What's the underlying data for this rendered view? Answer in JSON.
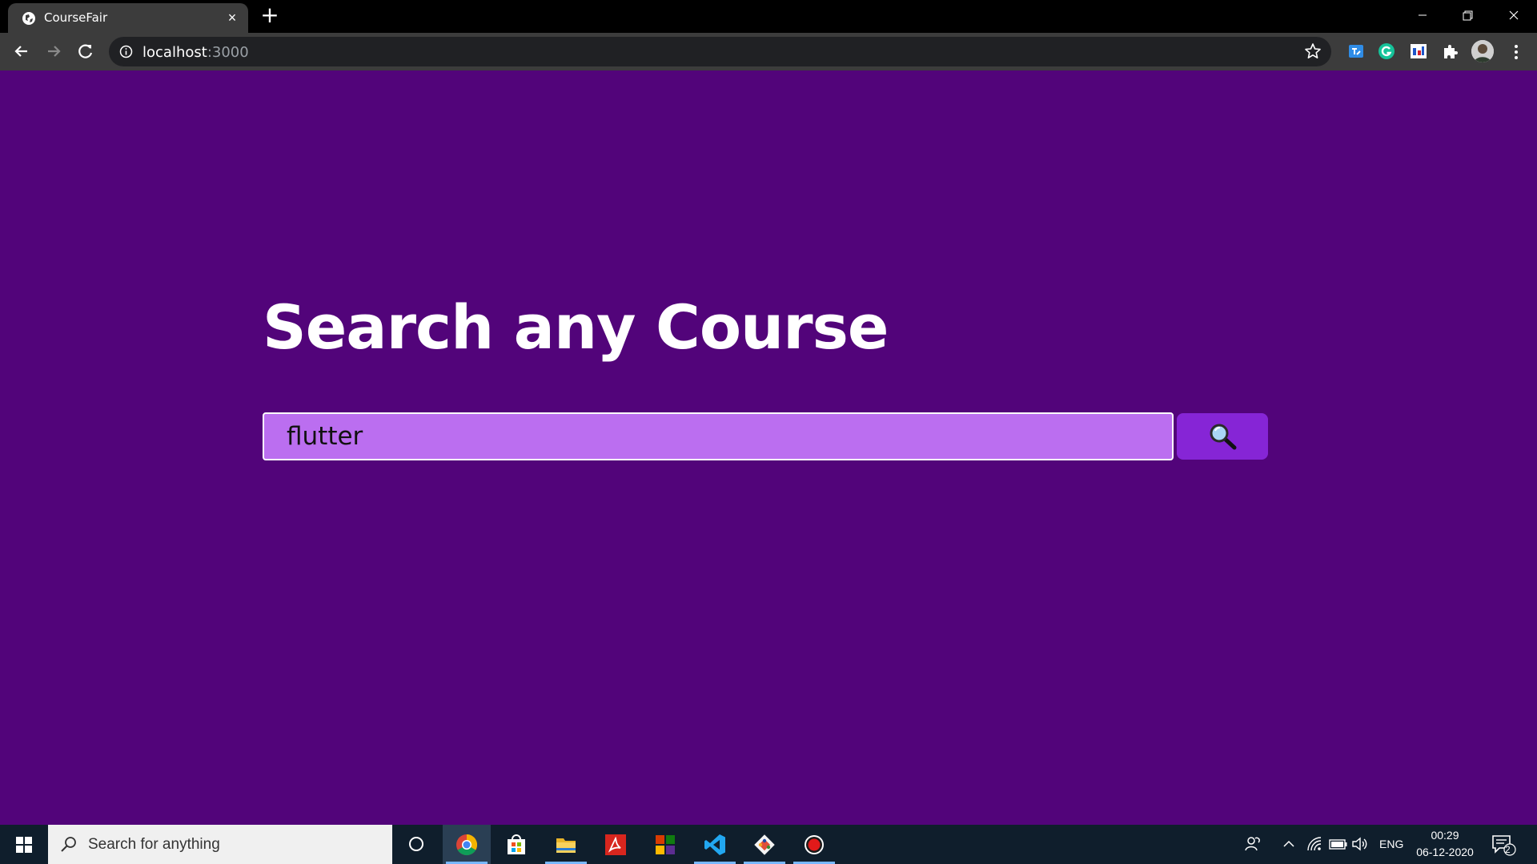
{
  "browser": {
    "tab_title": "CourseFair",
    "url_host": "localhost",
    "url_port": ":3000",
    "icons": {
      "favicon": "globe-icon",
      "tab_close": "close-icon",
      "new_tab": "plus-icon",
      "back": "arrow-left-icon",
      "forward": "arrow-right-icon",
      "reload": "reload-icon",
      "site_info": "info-icon",
      "bookmark": "star-icon",
      "extensions": [
        "translate-extension-icon",
        "grammarly-icon",
        "extension-app-icon",
        "puzzle-icon"
      ],
      "menu": "kebab-menu-icon"
    }
  },
  "page": {
    "title": "Search any Course",
    "search_value": "flutter",
    "search_button_icon": "magnifier-icon",
    "colors": {
      "background": "#52047a",
      "input_background": "#bb6ef0",
      "button_background": "#8625d6"
    }
  },
  "taskbar": {
    "search_placeholder": "Search for anything",
    "apps": [
      "chrome-icon",
      "store-icon",
      "file-explorer-icon",
      "acrobat-icon",
      "office-icon",
      "vscode-icon",
      "git-icon",
      "recorder-icon"
    ],
    "active_apps": [
      "chrome-icon",
      "file-explorer-icon",
      "vscode-icon",
      "git-icon",
      "recorder-icon"
    ],
    "language": "ENG",
    "time": "00:29",
    "date": "06-12-2020",
    "notification_count": "2"
  }
}
